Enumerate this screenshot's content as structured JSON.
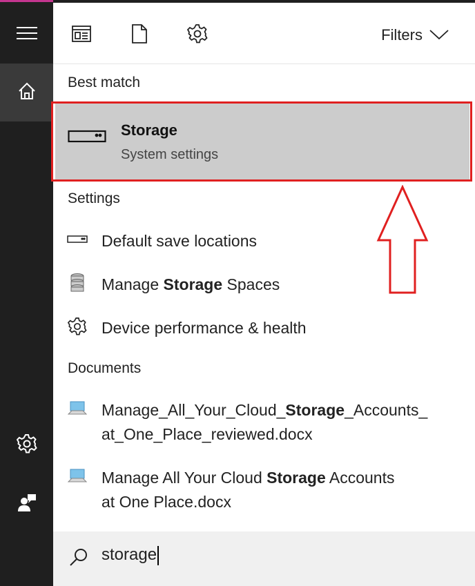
{
  "sidebar": {
    "items": [
      {
        "name": "menu",
        "icon": "hamburger-icon"
      },
      {
        "name": "home",
        "icon": "home-icon",
        "active": true
      },
      {
        "name": "settings",
        "icon": "gear-icon"
      },
      {
        "name": "feedback",
        "icon": "feedback-icon"
      }
    ]
  },
  "toolbar": {
    "filters_label": "Filters",
    "icons": [
      "apps-icon",
      "documents-icon",
      "settings-icon"
    ]
  },
  "sections": {
    "best_match": "Best match",
    "settings": "Settings",
    "documents": "Documents"
  },
  "best_match": {
    "title": "Storage",
    "subtitle": "System settings",
    "icon": "drive-icon"
  },
  "settings_results": [
    {
      "pre": "Default save locations",
      "bold": "",
      "post": "",
      "icon": "drive-icon"
    },
    {
      "pre": "Manage ",
      "bold": "Storage",
      "post": " Spaces",
      "icon": "storage-spaces-icon"
    },
    {
      "pre": "Device performance & health",
      "bold": "",
      "post": "",
      "icon": "gear-icon"
    }
  ],
  "document_results": [
    {
      "line1_pre": "Manage_All_Your_Cloud_",
      "line1_bold": "Storage",
      "line1_post": "_Accounts_",
      "line2": "at_One_Place_reviewed.docx",
      "icon": "document-pc-icon"
    },
    {
      "line1_pre": "Manage All Your Cloud ",
      "line1_bold": "Storage",
      "line1_post": " Accounts",
      "line2": "at One Place.docx",
      "icon": "document-pc-icon"
    }
  ],
  "search": {
    "query": "storage",
    "icon": "search-icon"
  },
  "colors": {
    "sidebar_bg": "#1f1f1f",
    "highlight_bg": "#cccccc",
    "annotation_red": "#e02020",
    "accent_pink": "#c4358f"
  }
}
